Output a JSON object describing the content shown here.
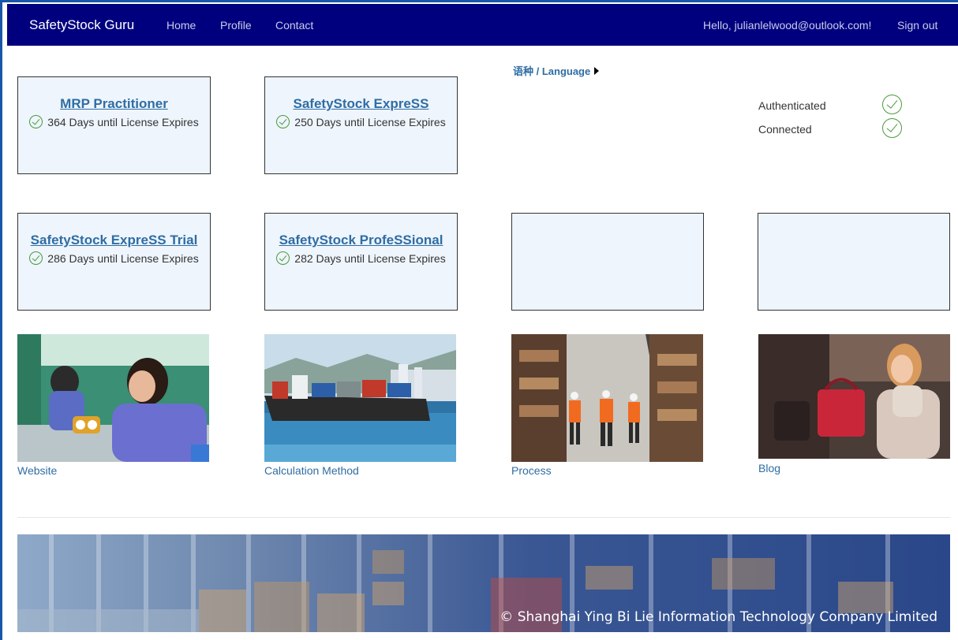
{
  "navbar": {
    "brand": "SafetyStock Guru",
    "links": [
      "Home",
      "Profile",
      "Contact"
    ],
    "greeting": "Hello, julianlelwood@outlook.com!",
    "signout": "Sign out",
    "bg_color": "#00007f"
  },
  "language": {
    "label": "语种 / Language"
  },
  "licenses": [
    {
      "title": "MRP Practitioner",
      "status": "364 Days until License Expires"
    },
    {
      "title": "SafetyStock ExpreSS",
      "status": "250 Days until License Expires"
    },
    {
      "title": "SafetyStock ExpreSS Trial",
      "status": "286 Days until License Expires"
    },
    {
      "title": "SafetyStock ProfeSSional",
      "status": "282 Days until License Expires"
    }
  ],
  "status": {
    "authenticated": "Authenticated",
    "connected": "Connected"
  },
  "tiles": [
    {
      "label": "Website"
    },
    {
      "label": "Calculation Method"
    },
    {
      "label": "Process"
    },
    {
      "label": "Blog"
    }
  ],
  "footer": {
    "copyright": "© Shanghai Ying Bi Lie Information Technology Company Limited"
  }
}
